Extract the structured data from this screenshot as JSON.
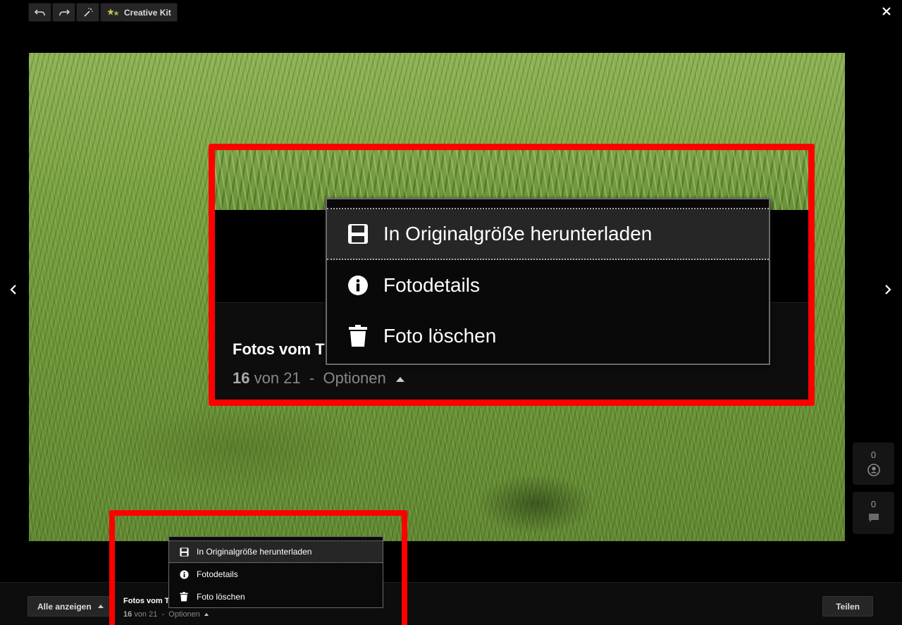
{
  "toolbar": {
    "undo_icon": "undo-icon",
    "redo_icon": "redo-icon",
    "magic_icon": "magic-wand-icon",
    "creative_kit_label": "Creative Kit"
  },
  "photo": {
    "description_icon": "grass-photo"
  },
  "counters": {
    "plus_ones": "0",
    "comments": "0"
  },
  "album": {
    "title": "Fotos vom T",
    "position_current": "16",
    "position_text": "von 21",
    "separator": "-",
    "options_label": "Optionen"
  },
  "options_menu": {
    "items": [
      {
        "label": "In Originalgröße herunterladen",
        "icon": "floppy-disk-icon"
      },
      {
        "label": "Fotodetails",
        "icon": "info-icon"
      },
      {
        "label": "Foto löschen",
        "icon": "trash-icon"
      }
    ]
  },
  "bottombar": {
    "show_all_label": "Alle anzeigen",
    "share_label": "Teilen"
  },
  "colors": {
    "highlight": "#ff0000",
    "menu_bg": "#0a0a0a",
    "button_bg": "#262626"
  }
}
